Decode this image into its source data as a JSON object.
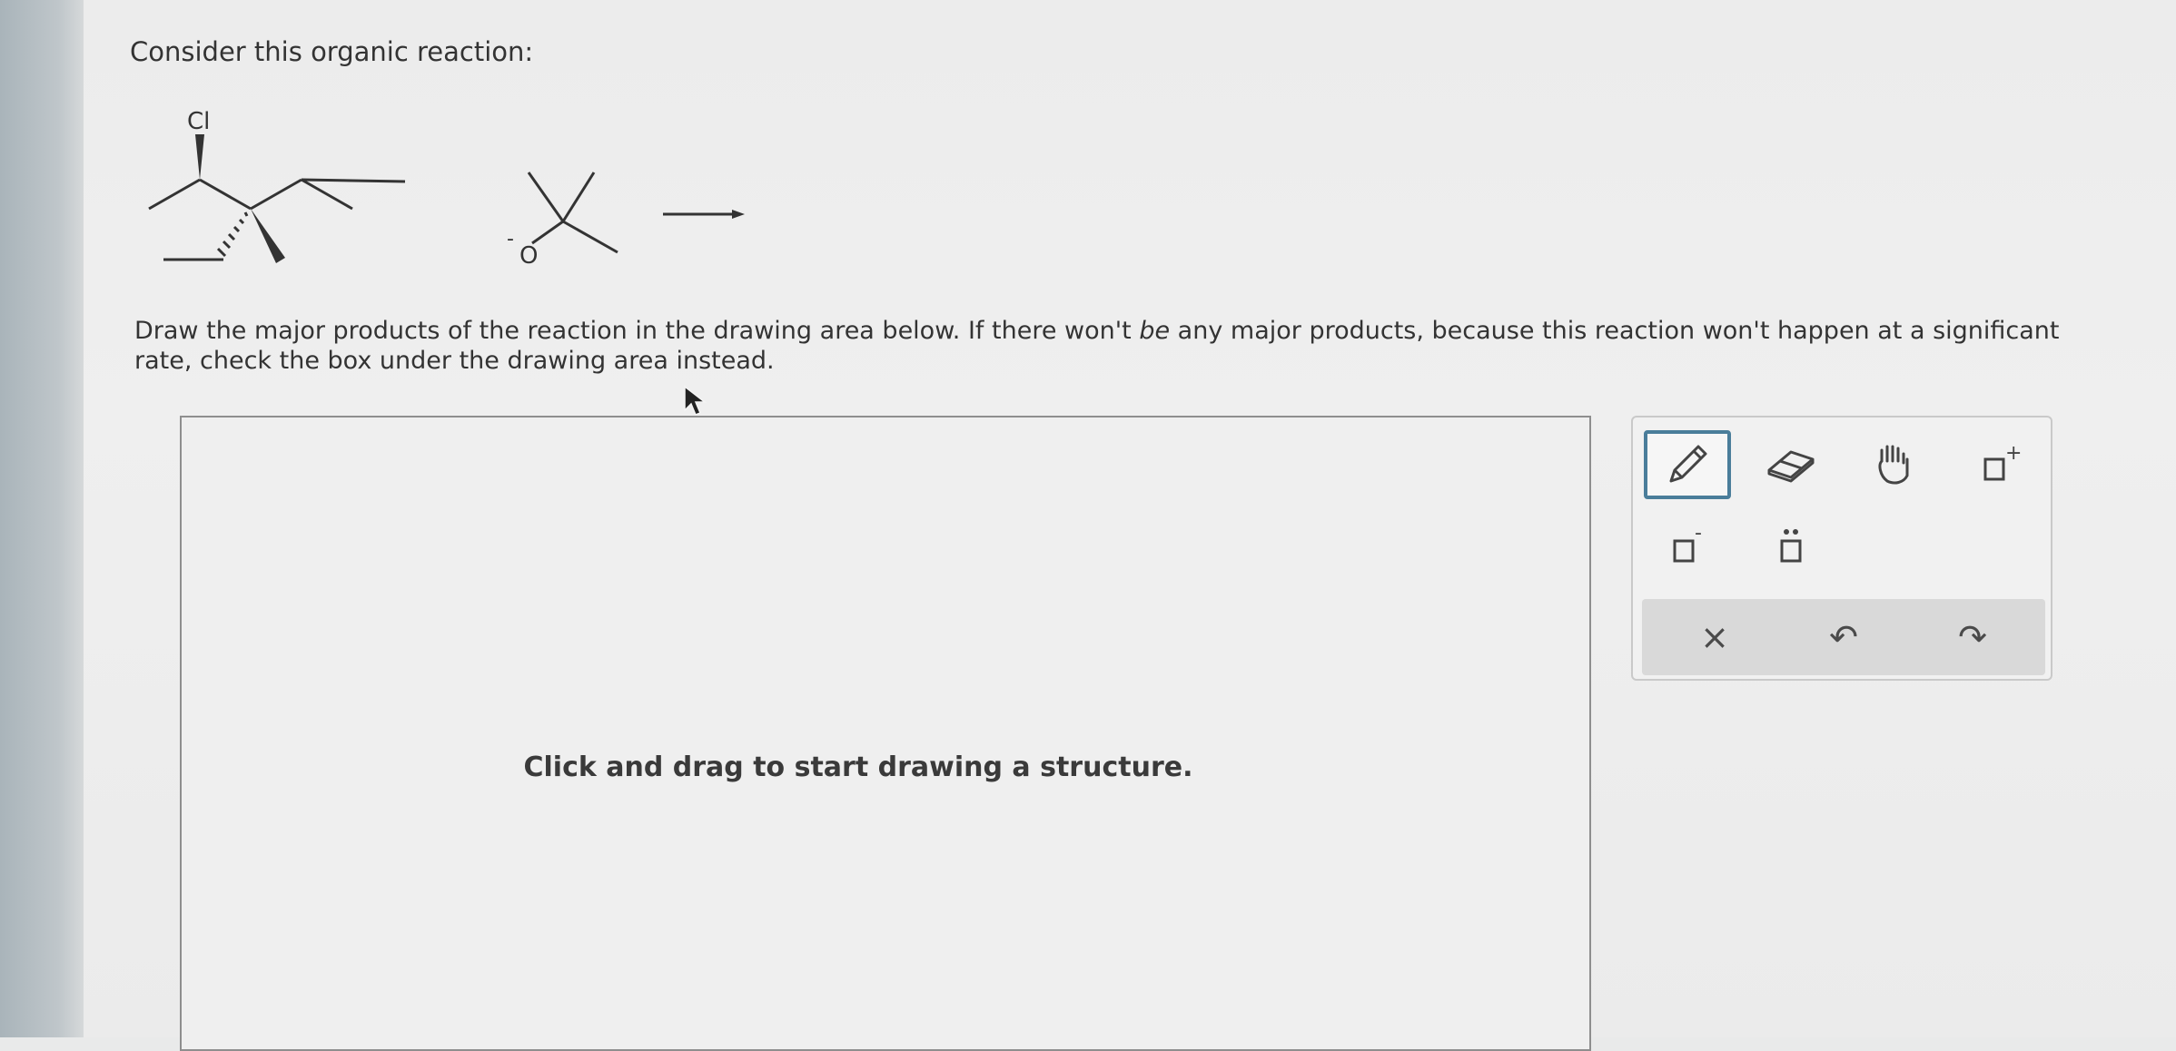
{
  "question": {
    "intro": "Consider this organic reaction:",
    "instructions_part1": "Draw the major products of the reaction in the drawing area below. If there won't ",
    "instructions_emphasis": "be",
    "instructions_part2": " any major products, because this reaction won't happen at a significant rate, check the box under the drawing area instead."
  },
  "reaction": {
    "substituent_label": "Cl",
    "nucleophile_atom": "O",
    "nucleophile_charge": "-"
  },
  "drawing_area": {
    "hint": "Click and drag to start drawing a structure."
  },
  "toolbox": {
    "tools": [
      {
        "name": "pencil-tool",
        "icon": "pencil-icon",
        "selected": true
      },
      {
        "name": "eraser-tool",
        "icon": "eraser-icon",
        "selected": false
      },
      {
        "name": "hand-tool",
        "icon": "hand-icon",
        "selected": false
      },
      {
        "name": "positive-charge-tool",
        "icon": "plus-charge-icon",
        "superscript": "+"
      },
      {
        "name": "negative-charge-tool",
        "icon": "minus-charge-icon",
        "superscript": "-"
      },
      {
        "name": "lone-pair-tool",
        "icon": "lone-pair-icon"
      }
    ],
    "actions": [
      {
        "name": "clear-button",
        "icon": "close-icon",
        "glyph": "×"
      },
      {
        "name": "undo-button",
        "icon": "undo-icon",
        "glyph": "↶"
      },
      {
        "name": "redo-button",
        "icon": "redo-icon",
        "glyph": "↷"
      }
    ]
  },
  "colors": {
    "accent": "#4a7d9a",
    "text": "#333333"
  }
}
